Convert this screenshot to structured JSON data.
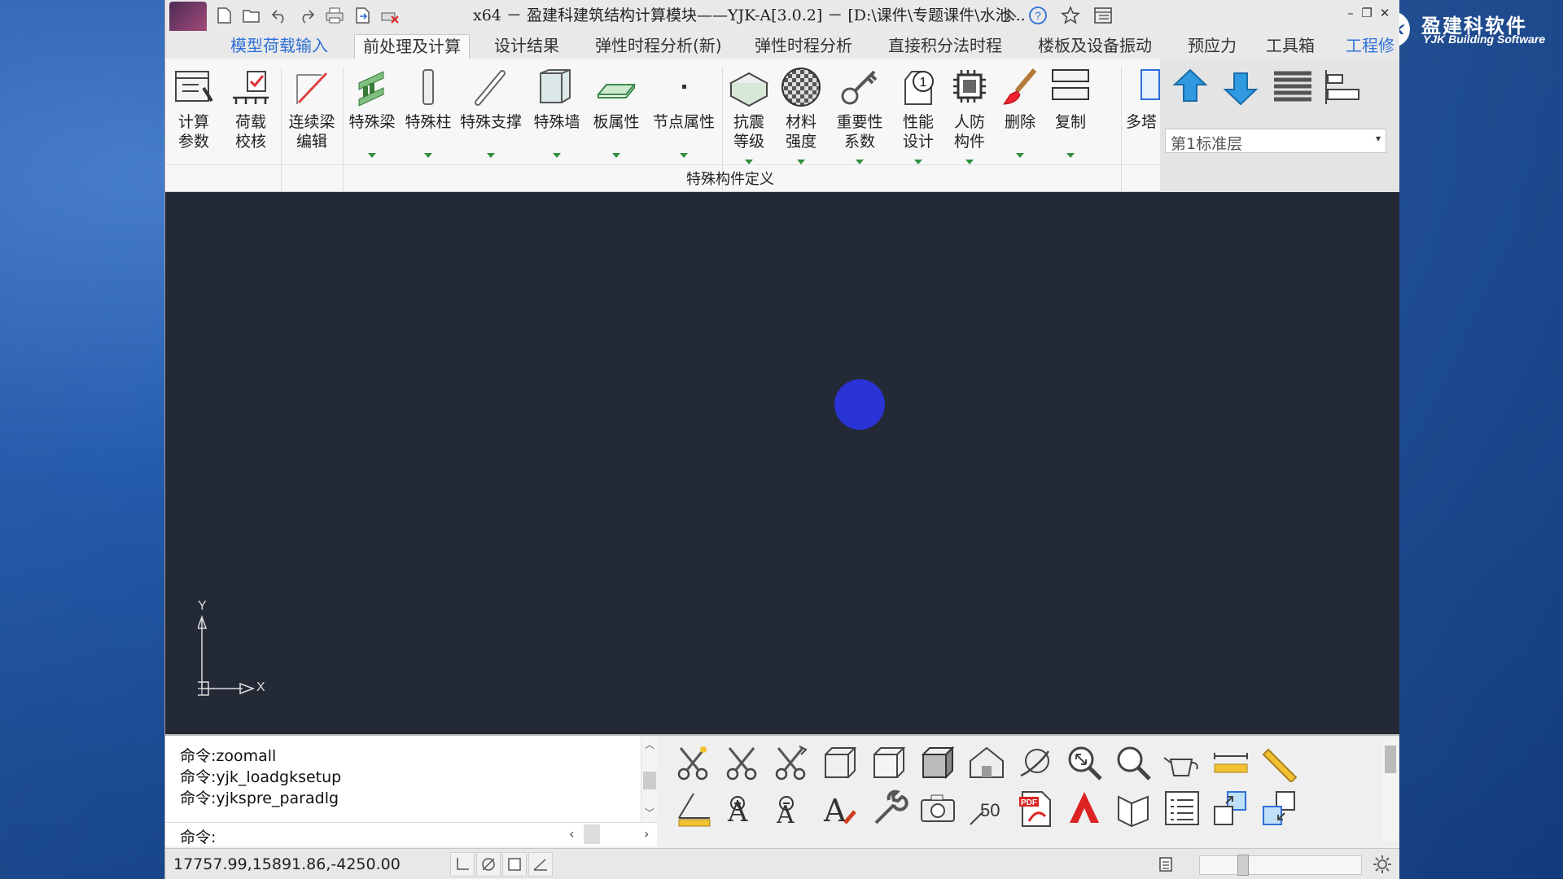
{
  "brand": {
    "cn": "盈建科软件",
    "en": "YJK Building Software",
    "badge": "YJK"
  },
  "title": "x64 － 盈建科建筑结构计算模块——YJK-A[3.0.2] － [D:\\课件\\专题课件\\水池...",
  "tabs": [
    {
      "label": "模型荷载输入",
      "state": "link"
    },
    {
      "label": "前处理及计算",
      "state": "active"
    },
    {
      "label": "设计结果"
    },
    {
      "label": "弹性时程分析(新)"
    },
    {
      "label": "弹性时程分析"
    },
    {
      "label": "直接积分法时程"
    },
    {
      "label": "楼板及设备振动"
    },
    {
      "label": "预应力"
    },
    {
      "label": "工具箱"
    },
    {
      "label": "工程修",
      "state": "link"
    }
  ],
  "ribbon": {
    "buttons": [
      {
        "label": "计算\n参数",
        "icon": "calc-params-icon"
      },
      {
        "label": "荷载\n校核",
        "icon": "load-check-icon"
      },
      {
        "label": "连续梁\n编辑",
        "icon": "continuous-beam-icon"
      },
      {
        "label": "特殊梁",
        "icon": "special-beam-icon"
      },
      {
        "label": "特殊柱",
        "icon": "special-column-icon"
      },
      {
        "label": "特殊支撑",
        "icon": "special-brace-icon"
      },
      {
        "label": "特殊墙",
        "icon": "special-wall-icon"
      },
      {
        "label": "板属性",
        "icon": "slab-property-icon"
      },
      {
        "label": "节点属性",
        "icon": "node-property-icon"
      },
      {
        "label": "抗震\n等级",
        "icon": "seismic-grade-icon"
      },
      {
        "label": "材料\n强度",
        "icon": "material-strength-icon"
      },
      {
        "label": "重要性\n系数",
        "icon": "importance-factor-icon"
      },
      {
        "label": "性能\n设计",
        "icon": "performance-design-icon"
      },
      {
        "label": "人防\n构件",
        "icon": "civil-defense-icon"
      },
      {
        "label": "删除",
        "icon": "delete-icon"
      },
      {
        "label": "复制",
        "icon": "copy-icon"
      },
      {
        "label": "多塔",
        "icon": "multi-tower-icon"
      }
    ],
    "group_label": "特殊构件定义"
  },
  "floor": {
    "selected": "第1标准层"
  },
  "command": {
    "history": [
      "命令:zoomall",
      "命令:yjk_loadgksetup",
      "命令:yjkspre_paradlg"
    ],
    "prompt": "命令:"
  },
  "status": {
    "coords": "17757.99,15891.86,-4250.00",
    "zoom_fraction": 0.25
  },
  "axis": {
    "x_label": "X",
    "y_label": "Y"
  },
  "colors": {
    "viewport_bg": "#232a36",
    "cursor": "#2a33d6",
    "tab_link": "#2f6fd8"
  }
}
